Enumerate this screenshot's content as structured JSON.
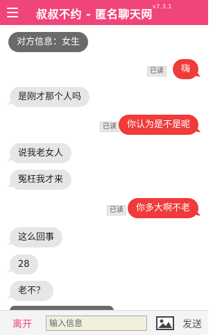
{
  "header": {
    "title": "叔叔不约 - 匿名聊天网",
    "version": "v7.3.1",
    "menu_icon": "hamburger-menu-icon"
  },
  "messages": [
    {
      "type": "info",
      "text": "对方信息：女生"
    },
    {
      "type": "sent",
      "text": "嗨",
      "status": "已读"
    },
    {
      "type": "recv",
      "text": "是刚才那个人吗"
    },
    {
      "type": "sent",
      "text": "你认为是不是呢",
      "status": "已读"
    },
    {
      "type": "recv",
      "text": "说我老女人"
    },
    {
      "type": "recv",
      "text": "冤枉我才来"
    },
    {
      "type": "sent",
      "text": "你多大啊不老",
      "status": "已读"
    },
    {
      "type": "recv",
      "text": "这么回事"
    },
    {
      "type": "recv",
      "text": "28"
    },
    {
      "type": "recv",
      "text": "老不？"
    }
  ],
  "footer": {
    "leave_label": "离开",
    "input_placeholder": "输入信息",
    "image_icon": "image-icon",
    "send_label": "发送"
  },
  "colors": {
    "header": "#f0457a",
    "sent_bubble": "#ef3b3b",
    "recv_bubble": "#e6e6e6",
    "info_bubble": "#6a6a6a"
  }
}
